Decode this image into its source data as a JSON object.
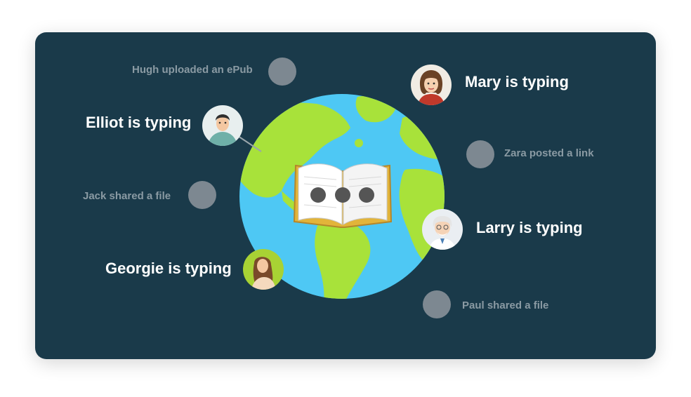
{
  "events": {
    "hugh": "Hugh uploaded an ePub",
    "mary": "Mary is typing",
    "elliot": "Elliot is typing",
    "zara": "Zara posted a link",
    "jack": "Jack shared a file",
    "larry": "Larry is typing",
    "georgie": "Georgie is typing",
    "paul": "Paul shared a file"
  },
  "icons": {
    "globe": "globe-icon",
    "book": "open-book-icon",
    "typing": "typing-dots-icon"
  },
  "colors": {
    "card_background": "#1a3a4a",
    "ocean": "#4ec8f4",
    "land": "#a8e23a",
    "book_frame": "#e2b43a",
    "activity_dot": "#7d8891",
    "typing_text": "#ffffff",
    "activity_text": "#8a9aa3"
  }
}
